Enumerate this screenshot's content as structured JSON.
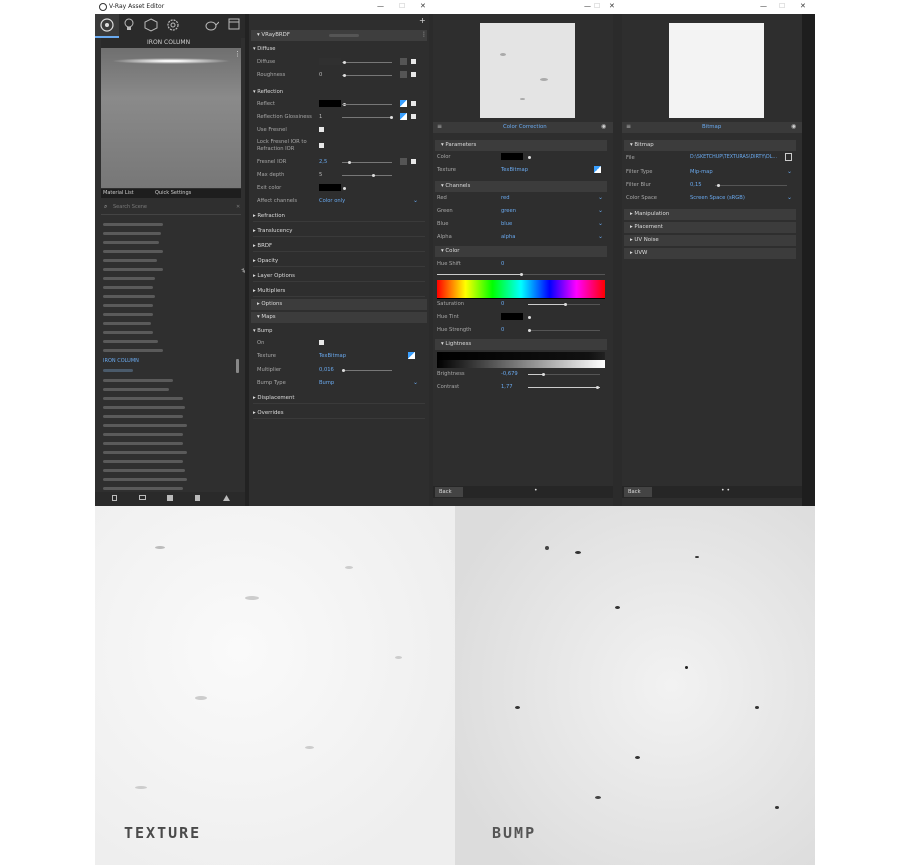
{
  "window": {
    "title": "V-Ray Asset Editor",
    "controls": [
      "—",
      "☐",
      "✕"
    ],
    "extra_controls": [
      "—",
      "☐",
      "✕",
      "—",
      "☐",
      "✕"
    ]
  },
  "left": {
    "preview_title": "IRON COLUMN",
    "tabs": [
      "Material List",
      "Quick Settings"
    ],
    "search_placeholder": "Search Scene",
    "selected_material": "IRON COLUMN",
    "bottom_icons": [
      "new-icon",
      "open-icon",
      "save-icon",
      "delete-icon",
      "clean-icon"
    ]
  },
  "brdf": {
    "header": "VRayBRDF",
    "diffuse_section": "Diffuse",
    "diffuse_label": "Diffuse",
    "roughness_label": "Roughness",
    "roughness_value": "0",
    "reflection_section": "Reflection",
    "reflect_label": "Reflect",
    "refl_gloss_label": "Reflection Glossiness",
    "refl_gloss_value": "1",
    "use_fresnel_label": "Use Fresnel",
    "lock_fresnel_label_1": "Lock Fresnel IOR to",
    "lock_fresnel_label_2": "Refraction IOR",
    "fresnel_ior_label": "Fresnel IOR",
    "fresnel_ior_value": "2,5",
    "max_depth_label": "Max depth",
    "max_depth_value": "5",
    "exit_color_label": "Exit color",
    "affect_channels_label": "Affect channels",
    "affect_channels_value": "Color only",
    "sections": [
      "Refraction",
      "Translucency",
      "BRDF",
      "Opacity",
      "Layer Options",
      "Multipliers"
    ],
    "options_label": "Options",
    "maps_label": "Maps",
    "bump_section": "Bump",
    "on_label": "On",
    "texture_label": "Texture",
    "texture_value": "TexBitmap",
    "multiplier_label": "Multiplier",
    "multiplier_value": "0,016",
    "bump_type_label": "Bump Type",
    "bump_type_value": "Bump",
    "displacement_label": "Displacement",
    "overrides_label": "Overrides"
  },
  "cc": {
    "title": "Color Correction",
    "params_section": "Parameters",
    "color_label": "Color",
    "texture_label": "Texture",
    "texture_value": "TexBitmap",
    "channels_section": "Channels",
    "red_label": "Red",
    "red_value": "red",
    "green_label": "Green",
    "green_value": "green",
    "blue_label": "Blue",
    "blue_value": "blue",
    "alpha_label": "Alpha",
    "alpha_value": "alpha",
    "color_section": "Color",
    "hue_shift_label": "Hue Shift",
    "hue_shift_value": "0",
    "saturation_label": "Saturation",
    "saturation_value": "0",
    "hue_tint_label": "Hue Tint",
    "hue_strength_label": "Hue Strength",
    "hue_strength_value": "0",
    "lightness_section": "Lightness",
    "brightness_label": "Brightness",
    "brightness_value": "-0,679",
    "contrast_label": "Contrast",
    "contrast_value": "1,77",
    "back_label": "Back",
    "dots": "•"
  },
  "bitmap": {
    "title": "Bitmap",
    "bitmap_section": "Bitmap",
    "file_label": "File",
    "file_value": "D:\\SKETCHUP\\TEXTURAS\\DIRTY\\DL...",
    "filter_type_label": "Filter Type",
    "filter_type_value": "Mip-map",
    "filter_blur_label": "Filter Blur",
    "filter_blur_value": "0,15",
    "color_space_label": "Color Space",
    "color_space_value": "Screen Space (sRGB)",
    "sections": [
      "Manipulation",
      "Placement",
      "UV Noise",
      "UVW"
    ],
    "back_label": "Back",
    "dots": "• •"
  },
  "bottom": {
    "texture_title": "TEXTURE",
    "bump_title": "BUMP"
  },
  "colors": {
    "accent": "#6aaaf0",
    "panel": "#333333",
    "window": "#2b2b2b"
  }
}
